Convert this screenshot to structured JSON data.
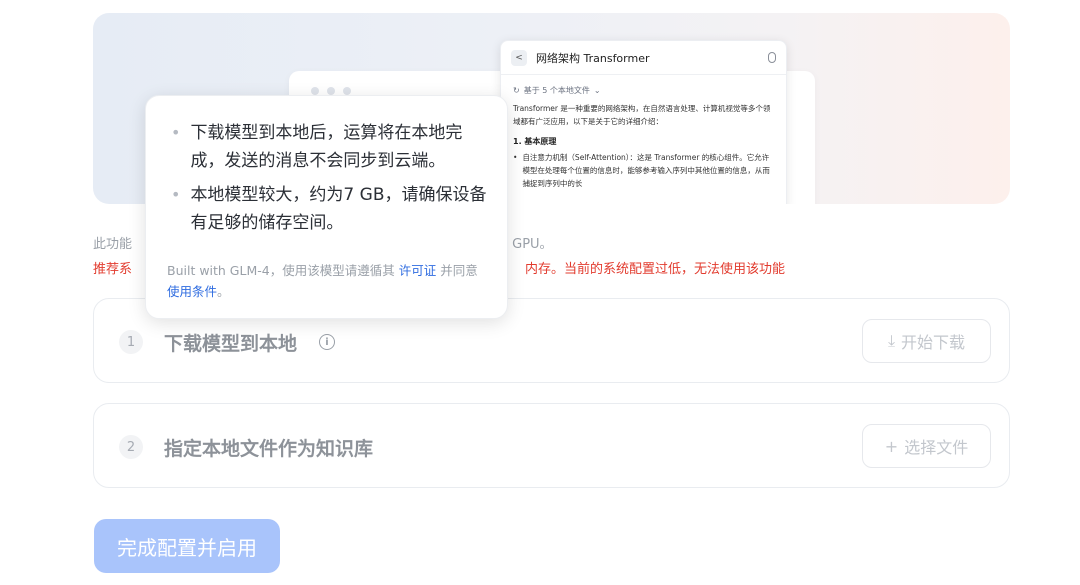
{
  "preview": {
    "chat_title": "网络架构 Transformer",
    "source_meta": "基于 5 个本地文件",
    "intro": "Transformer 是一种重要的网络架构，在自然语言处理、计算机视觉等多个领域都有广泛应用，以下是关于它的详细介绍：",
    "section_heading": "1. 基本原理",
    "bullet_text": "自注意力机制（Self-Attention）：这是 Transformer 的核心组件。它允许模型在处理每个位置的信息时，能够参考输入序列中其他位置的信息，从而捕捉到序列中的长"
  },
  "info": {
    "line1_left": "此功能",
    "line1_right": "系 GPU。",
    "line2_left": "推荐系",
    "line2_right": "内存。当前的系统配置过低，无法使用该功能"
  },
  "steps": [
    {
      "number": "1",
      "title": "下载模型到本地",
      "button_label": "开始下载",
      "button_icon": "download-icon"
    },
    {
      "number": "2",
      "title": "指定本地文件作为知识库",
      "button_label": "选择文件",
      "button_icon": "plus-icon"
    }
  ],
  "tooltip": {
    "items": [
      "下载模型到本地后，运算将在本地完成，发送的消息不会同步到云端。",
      "本地模型较大，约为7 GB，请确保设备有足够的储存空间。"
    ],
    "footer_prefix": "Built with GLM-4，使用该模型请遵循其",
    "license_link": "许可证",
    "footer_middle": "并同意",
    "terms_link": "使用条件",
    "footer_suffix": "。"
  },
  "primary_button": "完成配置并启用",
  "colors": {
    "primary_disabled": "#a9c4fb",
    "warning_text": "#e23b2e",
    "link": "#2f6ce0"
  }
}
